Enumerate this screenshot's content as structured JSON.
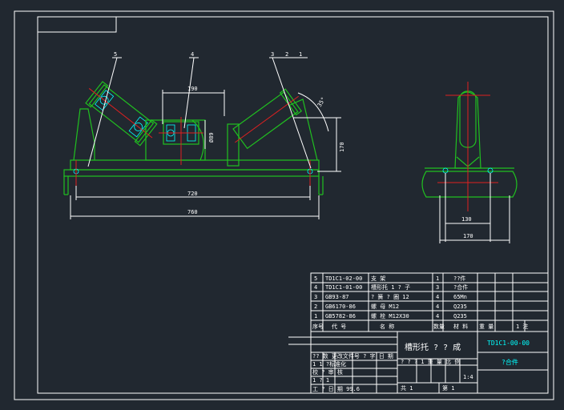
{
  "drawing": {
    "balloons": [
      "5",
      "4",
      "3",
      "2",
      "1"
    ],
    "dimensions": {
      "d190": "190",
      "d89": "Ø89",
      "d170_height": "170",
      "d35": "35°",
      "d720": "720",
      "d760": "760",
      "d130": "130",
      "d170_width": "170"
    }
  },
  "bom": {
    "rows": [
      {
        "no": "5",
        "code": "TD1C1-02-00",
        "name": "支 架",
        "qty": "1",
        "material": "??件"
      },
      {
        "no": "4",
        "code": "TD1C1-01-00",
        "name": "槽形托 1 ? 子",
        "qty": "3",
        "material": "?合件"
      },
      {
        "no": "3",
        "code": "GB93-87",
        "name": "? 簧 ? 圈 12",
        "qty": "4",
        "material": "65Mn"
      },
      {
        "no": "2",
        "code": "GB6170-86",
        "name": "螺 母 M12",
        "qty": "4",
        "material": "Q235"
      },
      {
        "no": "1",
        "code": "GB5782-86",
        "name": "螺 栓 M12X30",
        "qty": "4",
        "material": "Q235"
      }
    ],
    "header": {
      "no": "序号",
      "code": "代 号",
      "name": "名 称",
      "qty": "数量",
      "material": "材 料",
      "weight": "重 量",
      "note": "1 注"
    }
  },
  "title_block": {
    "part_name": "槽形托 ? ? 成",
    "drawing_no": "TD1C1-00-00",
    "type": "?合件",
    "rows_left": [
      "?? 数 更改文件号 ? 字 日 期",
      "1 1 ?标准化",
      "校 ? 审 核",
      "1 ? 1",
      "工 ? 日 期 99.6"
    ],
    "stage_header": "? ? ? 1 重 量 比 例",
    "scale": "1:4",
    "sheet_total": "共 1",
    "sheet_current": "第 1"
  }
}
